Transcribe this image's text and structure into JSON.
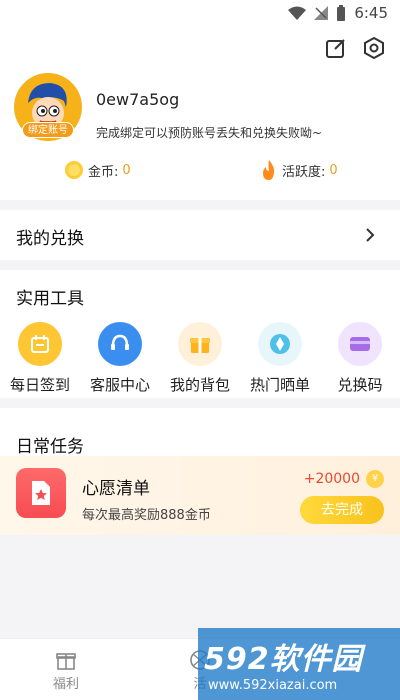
{
  "status_bar": {
    "time": "6:45"
  },
  "profile": {
    "username": "0ew7a5og",
    "badge": "绑定账号",
    "bind_tip": "完成绑定可以预防账号丢失和兑换失败呦~",
    "coins_label": "金币:",
    "coins_value": "0",
    "activity_label": "活跃度:",
    "activity_value": "0"
  },
  "exchange": {
    "title": "我的兑换"
  },
  "tools": {
    "title": "实用工具",
    "items": [
      {
        "label": "每日签到",
        "icon": "calendar-icon"
      },
      {
        "label": "客服中心",
        "icon": "headset-icon"
      },
      {
        "label": "我的背包",
        "icon": "gift-icon"
      },
      {
        "label": "热门晒单",
        "icon": "diamond-icon"
      },
      {
        "label": "兑换码",
        "icon": "card-icon"
      }
    ]
  },
  "tasks": {
    "title": "日常任务",
    "card": {
      "name": "心愿清单",
      "desc": "每次最高奖励888金币",
      "reward": "+20000",
      "coin_symbol": "¥",
      "button": "去完成"
    }
  },
  "tabbar": {
    "tabs": [
      {
        "label": "福利"
      },
      {
        "label": "活"
      }
    ]
  },
  "watermark": {
    "brand": "592软件园",
    "url": "www.592xiazai.com"
  },
  "colors": {
    "accent_orange": "#f7b21a",
    "reward_red": "#e84a30",
    "button_yellow": "#f8c21c"
  }
}
